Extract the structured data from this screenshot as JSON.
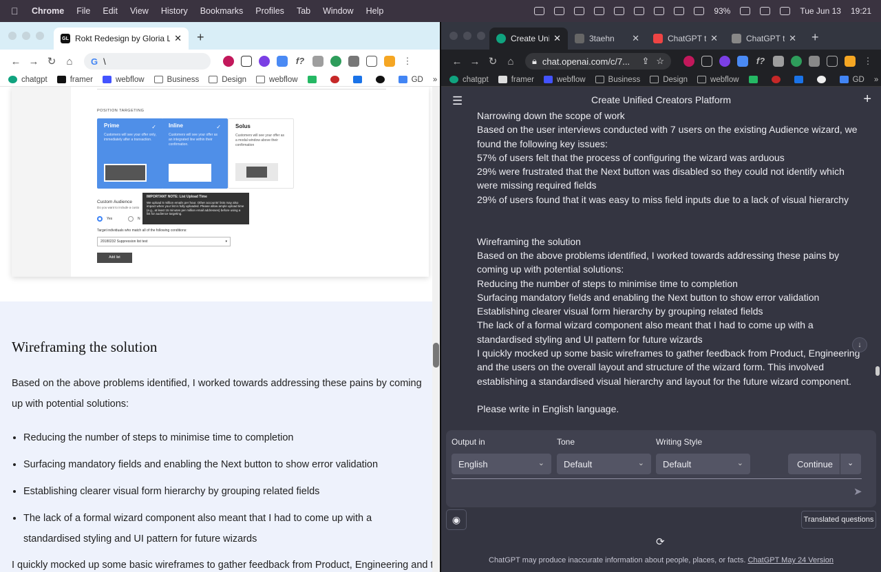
{
  "menubar": {
    "app": "Chrome",
    "items": [
      "File",
      "Edit",
      "View",
      "History",
      "Bookmarks",
      "Profiles",
      "Tab",
      "Window",
      "Help"
    ],
    "battery": "93%",
    "date": "Tue Jun 13",
    "time": "19:21"
  },
  "left_window": {
    "tab": {
      "favicon_text": "GL",
      "title": "Rokt Redesign by Gloria Lo"
    },
    "omnibox": "\\",
    "bookmarks": [
      "chatgpt",
      "framer",
      "webflow",
      "Business",
      "Design",
      "webflow",
      "GD"
    ],
    "screenshot": {
      "section_label": "POSITION TARGETING",
      "cards": [
        {
          "title": "Prime",
          "desc": "Customers will see your offer only, immediately after a transaction.",
          "color": "#4f8fe8"
        },
        {
          "title": "Inline",
          "desc": "Customers will see your offer as an integrated line within their confirmation.",
          "color": "#4f8fe8"
        },
        {
          "title": "Solus",
          "desc": "Customers will see your offer as a modal window above their confirmation",
          "color": "#ffffff"
        }
      ],
      "custom_audience_label": "Custom Audience",
      "custom_audience_sub": "Do you want to include a custo",
      "radio_yes": "Yes",
      "radio_no": "N",
      "target_label": "Target individuals who match all of the following conditions:",
      "select_value": "20180232 Suppression list test",
      "add_list": "Add list",
      "tooltip_title": "IMPORTANT NOTE: List Upload Time",
      "tooltip_body": "We upload 5 million emails per hour. Other accounts' lists may also impact when your list is fully uploaded. Please allow ample upload time (e.g., at least 15 minutes per million email addresses) before using a list for audience targeting."
    },
    "article": {
      "heading": "Wireframing the solution",
      "intro": "Based on the above problems identified, I worked towards addressing these pains by coming up with potential solutions:",
      "bullets": [
        "Reducing the number of steps to minimise time to completion",
        "Surfacing mandatory fields and enabling the Next button to show error validation",
        "Establishing clearer visual form hierarchy by grouping related fields",
        "The lack of a formal wizard component also meant that I had to come up with a standardised styling and UI pattern for future wizards"
      ],
      "tail": "I quickly mocked up some basic wireframes to gather feedback from Product, Engineering and the"
    }
  },
  "right_window": {
    "tabs": [
      {
        "title": "Create Unifie",
        "fav_color": "#10a37f"
      },
      {
        "title": "3taehn",
        "fav_color": "#666"
      },
      {
        "title": "ChatGPT to",
        "fav_color": "#e44"
      },
      {
        "title": "ChatGPT to",
        "fav_color": "#888"
      }
    ],
    "omnibox": "chat.openai.com/c/7...",
    "bookmarks": [
      "chatgpt",
      "framer",
      "webflow",
      "Business",
      "Design",
      "webflow",
      "GD"
    ],
    "chat_title": "Create Unified Creators Platform",
    "messages": [
      "Narrowing down the scope of work",
      "Based on the user interviews conducted with 7 users on the existing Audience wizard, we found the following key issues:",
      "57% of users felt that the process of configuring the wizard was arduous",
      "29% were frustrated that the Next button was disabled so they could not identify which were missing required fields",
      "29% of users found that it was easy to miss field inputs due to a lack of visual hierarchy",
      "",
      "",
      "Wireframing the solution",
      "Based on the above problems identified, I worked towards addressing these pains by coming up with potential solutions:",
      "Reducing the number of steps to minimise time to completion",
      "Surfacing mandatory fields and enabling the Next button to show error validation",
      "Establishing clearer visual form hierarchy by grouping related fields",
      "The lack of a formal wizard component also meant that I had to come up with a standardised styling and UI pattern for future wizards",
      "I quickly mocked up some basic wireframes to gather feedback from Product, Engineering and the users on the overall layout and structure of the wizard form. This involved establishing a standardised visual hierarchy and layout for the future wizard component.",
      "",
      "Please write in English language."
    ],
    "controls": {
      "output_label": "Output in",
      "output_value": "English",
      "tone_label": "Tone",
      "tone_value": "Default",
      "style_label": "Writing Style",
      "style_value": "Default",
      "continue": "Continue"
    },
    "translated_questions": "Translated questions",
    "footer_text": "ChatGPT may produce inaccurate information about people, places, or facts.",
    "footer_link": "ChatGPT May 24 Version"
  }
}
